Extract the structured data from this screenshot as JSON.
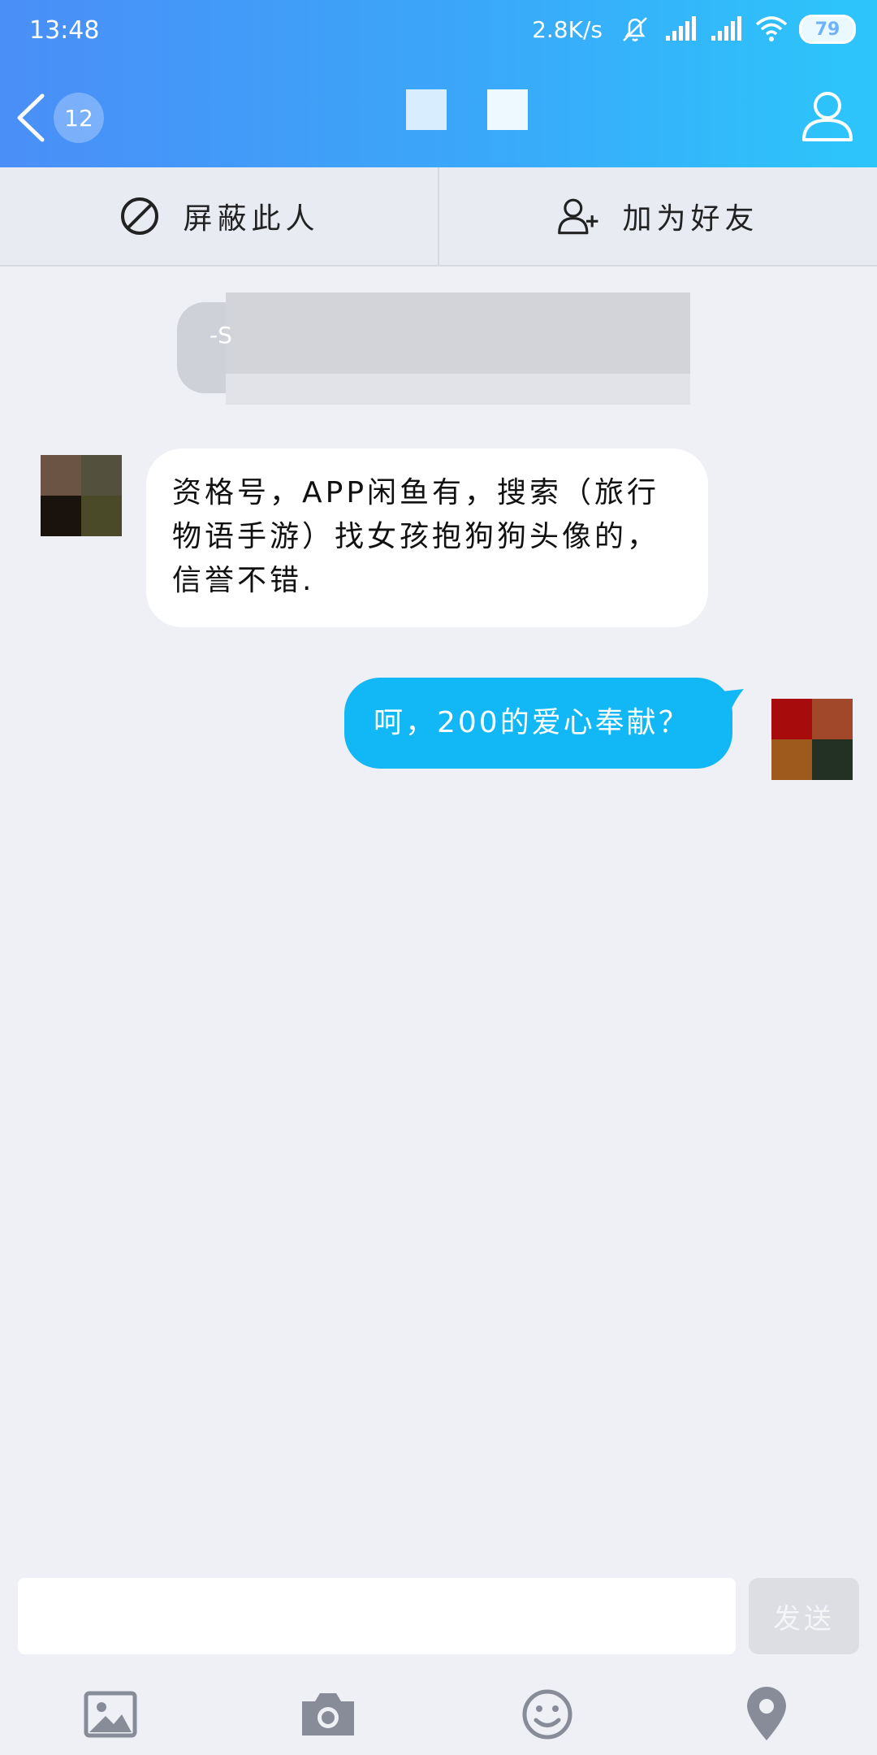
{
  "status_bar": {
    "time": "13:48",
    "net_speed": "2.8K/s",
    "battery": "79",
    "icons": [
      "bell-off-icon",
      "signal-icon",
      "signal-icon",
      "wifi-icon",
      "battery-icon"
    ]
  },
  "nav": {
    "unread_count": "12",
    "back_icon": "chevron-left-icon",
    "profile_icon": "user-icon"
  },
  "actions": {
    "block_label": "屏蔽此人",
    "add_friend_label": "加为好友"
  },
  "system_notice": {
    "text": "-S"
  },
  "messages": [
    {
      "direction": "incoming",
      "text": "资格号，APP闲鱼有，搜索（旅行物语手游）找女孩抱狗狗头像的，信誉不错."
    },
    {
      "direction": "outgoing",
      "text": "呵，200的爱心奉献？"
    }
  ],
  "composer": {
    "input_value": "",
    "send_label": "发送"
  },
  "toolbar": {
    "items": [
      "image-icon",
      "camera-icon",
      "emoji-icon",
      "location-icon"
    ]
  },
  "colors": {
    "header_start": "#4a8ef7",
    "header_end": "#2cc6fb",
    "outgoing_bubble": "#12b7f5",
    "background": "#eef0f6"
  }
}
